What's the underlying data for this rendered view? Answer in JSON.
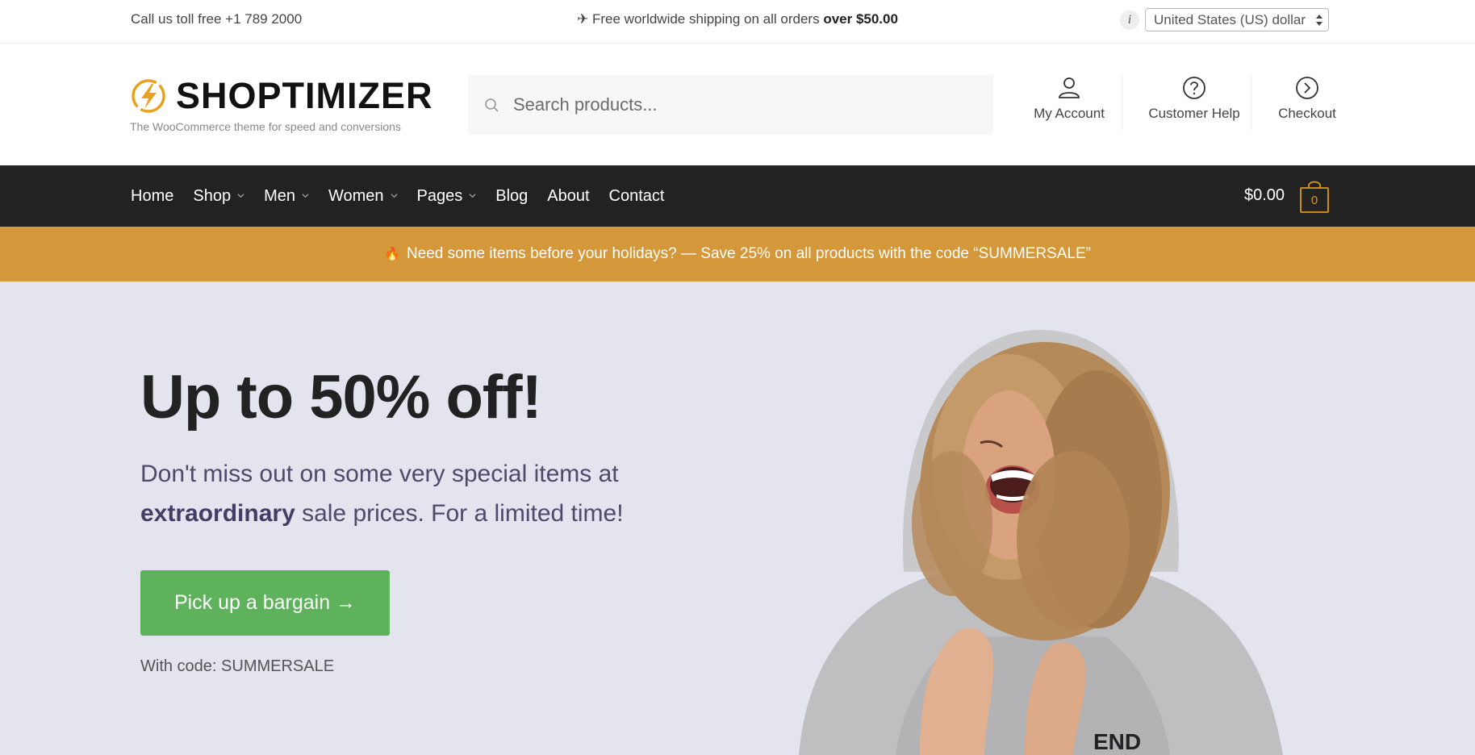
{
  "topbar": {
    "call_text": "Call us toll free +1 789 2000",
    "shipping_prefix": "✈ Free worldwide shipping on all orders ",
    "shipping_bold": "over $50.00",
    "info_icon": "i",
    "currency_selected": "United States (US) dollar"
  },
  "header": {
    "logo_name": "SHOPTIMIZER",
    "logo_tagline": "The WooCommerce theme for speed and conversions",
    "search_placeholder": "Search products...",
    "links": [
      {
        "label": "My Account",
        "icon": "user-icon"
      },
      {
        "label": "Customer Help",
        "icon": "help-circle-icon"
      },
      {
        "label": "Checkout",
        "icon": "chevron-right-circle-icon"
      }
    ]
  },
  "nav": {
    "items": [
      {
        "label": "Home",
        "has_dropdown": false
      },
      {
        "label": "Shop",
        "has_dropdown": true
      },
      {
        "label": "Men",
        "has_dropdown": true
      },
      {
        "label": "Women",
        "has_dropdown": true
      },
      {
        "label": "Pages",
        "has_dropdown": true
      },
      {
        "label": "Blog",
        "has_dropdown": false
      },
      {
        "label": "About",
        "has_dropdown": false
      },
      {
        "label": "Contact",
        "has_dropdown": false
      }
    ],
    "cart_total": "$0.00",
    "cart_count": "0"
  },
  "promo": {
    "icon": "🔥",
    "text": "Need some items before your holidays? — Save 25% on all products with the code “SUMMERSALE”"
  },
  "hero": {
    "title": "Up to 50% off!",
    "subtitle_line1": "Don't miss out on some very special items at",
    "subtitle_bold": "extraordinary",
    "subtitle_rest": " sale prices. For a limited time!",
    "cta_label": "Pick up a bargain →",
    "code_text": "With code: SUMMERSALE",
    "image_alt": "Laughing woman with curly hair wearing a grey hoodie"
  },
  "colors": {
    "accent": "#dc9814",
    "nav_bg": "#222222",
    "promo_bg": "#d4983a",
    "hero_bg": "#e3e4ee",
    "cta_bg": "#5db25b"
  }
}
